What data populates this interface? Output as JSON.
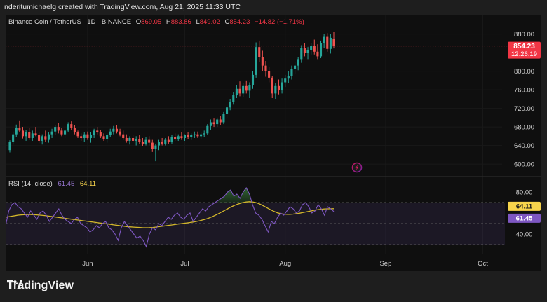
{
  "credit": "nderitumichaelg created with TradingView.com, Aug 21, 2025 11:33 UTC",
  "brand": {
    "name": "TradingView"
  },
  "colors": {
    "up": "#26a69a",
    "down": "#ef5350",
    "rsi_line": "#7e57c2",
    "rsi_ma": "#d4b82a",
    "price_tag": "#f23645",
    "rsi_tag_ma": "#f7d44c",
    "rsi_tag_line": "#7e57c2",
    "background": "#0f0f0f"
  },
  "legend": {
    "symbol": "Binance Coin / TetherUS · 1D · BINANCE",
    "o_label": "O",
    "o": "869.05",
    "h_label": "H",
    "h": "883.86",
    "l_label": "L",
    "l": "849.02",
    "c_label": "C",
    "c": "854.23",
    "change": "−14.82 (−1.71%)"
  },
  "price_tag": {
    "value": "854.23",
    "countdown": "12:26:19"
  },
  "rsi_legend": {
    "name": "RSI (14, close)",
    "value": "61.45",
    "ma_value": "64.11"
  },
  "rsi_tags": {
    "ma": "64.11",
    "line": "61.45"
  },
  "chart_data": [
    {
      "type": "candlestick",
      "title": "Binance Coin / TetherUS · 1D · BINANCE",
      "yticks": [
        "880.00",
        "800.00",
        "760.00",
        "720.00",
        "680.00",
        "640.00",
        "600.00"
      ],
      "ylim": [
        585,
        893
      ],
      "xticks": [
        "Jun",
        "Jul",
        "Aug",
        "Sep",
        "Oct"
      ],
      "last_close": 854.23,
      "candles": [
        {
          "o": 630,
          "h": 651,
          "l": 625,
          "c": 648
        },
        {
          "o": 648,
          "h": 670,
          "l": 642,
          "c": 664
        },
        {
          "o": 664,
          "h": 685,
          "l": 658,
          "c": 678
        },
        {
          "o": 678,
          "h": 694,
          "l": 668,
          "c": 672
        },
        {
          "o": 672,
          "h": 680,
          "l": 655,
          "c": 660
        },
        {
          "o": 660,
          "h": 674,
          "l": 650,
          "c": 668
        },
        {
          "o": 668,
          "h": 678,
          "l": 652,
          "c": 656
        },
        {
          "o": 656,
          "h": 672,
          "l": 650,
          "c": 666
        },
        {
          "o": 666,
          "h": 680,
          "l": 660,
          "c": 662
        },
        {
          "o": 662,
          "h": 668,
          "l": 645,
          "c": 650
        },
        {
          "o": 650,
          "h": 664,
          "l": 642,
          "c": 660
        },
        {
          "o": 660,
          "h": 672,
          "l": 648,
          "c": 652
        },
        {
          "o": 652,
          "h": 668,
          "l": 646,
          "c": 664
        },
        {
          "o": 664,
          "h": 676,
          "l": 656,
          "c": 670
        },
        {
          "o": 670,
          "h": 684,
          "l": 662,
          "c": 680
        },
        {
          "o": 680,
          "h": 688,
          "l": 666,
          "c": 672
        },
        {
          "o": 672,
          "h": 678,
          "l": 660,
          "c": 664
        },
        {
          "o": 664,
          "h": 676,
          "l": 656,
          "c": 672
        },
        {
          "o": 672,
          "h": 690,
          "l": 668,
          "c": 686
        },
        {
          "o": 686,
          "h": 692,
          "l": 674,
          "c": 678
        },
        {
          "o": 678,
          "h": 684,
          "l": 664,
          "c": 668
        },
        {
          "o": 668,
          "h": 672,
          "l": 656,
          "c": 660
        },
        {
          "o": 660,
          "h": 666,
          "l": 650,
          "c": 656
        },
        {
          "o": 656,
          "h": 668,
          "l": 648,
          "c": 664
        },
        {
          "o": 664,
          "h": 670,
          "l": 652,
          "c": 656
        },
        {
          "o": 656,
          "h": 668,
          "l": 646,
          "c": 662
        },
        {
          "o": 662,
          "h": 676,
          "l": 656,
          "c": 672
        },
        {
          "o": 672,
          "h": 680,
          "l": 664,
          "c": 668
        },
        {
          "o": 668,
          "h": 674,
          "l": 656,
          "c": 660
        },
        {
          "o": 660,
          "h": 666,
          "l": 650,
          "c": 654
        },
        {
          "o": 654,
          "h": 666,
          "l": 646,
          "c": 662
        },
        {
          "o": 662,
          "h": 676,
          "l": 658,
          "c": 670
        },
        {
          "o": 670,
          "h": 682,
          "l": 664,
          "c": 676
        },
        {
          "o": 676,
          "h": 684,
          "l": 666,
          "c": 670
        },
        {
          "o": 670,
          "h": 676,
          "l": 660,
          "c": 664
        },
        {
          "o": 664,
          "h": 672,
          "l": 652,
          "c": 656
        },
        {
          "o": 656,
          "h": 664,
          "l": 646,
          "c": 650
        },
        {
          "o": 650,
          "h": 660,
          "l": 642,
          "c": 656
        },
        {
          "o": 656,
          "h": 662,
          "l": 646,
          "c": 650
        },
        {
          "o": 650,
          "h": 660,
          "l": 640,
          "c": 654
        },
        {
          "o": 654,
          "h": 662,
          "l": 644,
          "c": 648
        },
        {
          "o": 648,
          "h": 656,
          "l": 638,
          "c": 644
        },
        {
          "o": 644,
          "h": 658,
          "l": 640,
          "c": 652
        },
        {
          "o": 652,
          "h": 660,
          "l": 640,
          "c": 646
        },
        {
          "o": 646,
          "h": 652,
          "l": 626,
          "c": 632
        },
        {
          "o": 632,
          "h": 644,
          "l": 606,
          "c": 640
        },
        {
          "o": 640,
          "h": 652,
          "l": 630,
          "c": 648
        },
        {
          "o": 648,
          "h": 656,
          "l": 640,
          "c": 644
        },
        {
          "o": 644,
          "h": 656,
          "l": 640,
          "c": 652
        },
        {
          "o": 652,
          "h": 660,
          "l": 644,
          "c": 648
        },
        {
          "o": 648,
          "h": 662,
          "l": 644,
          "c": 658
        },
        {
          "o": 658,
          "h": 666,
          "l": 650,
          "c": 654
        },
        {
          "o": 654,
          "h": 664,
          "l": 650,
          "c": 660
        },
        {
          "o": 660,
          "h": 668,
          "l": 652,
          "c": 656
        },
        {
          "o": 656,
          "h": 664,
          "l": 650,
          "c": 662
        },
        {
          "o": 662,
          "h": 668,
          "l": 654,
          "c": 658
        },
        {
          "o": 658,
          "h": 666,
          "l": 652,
          "c": 662
        },
        {
          "o": 662,
          "h": 670,
          "l": 656,
          "c": 664
        },
        {
          "o": 664,
          "h": 670,
          "l": 656,
          "c": 660
        },
        {
          "o": 660,
          "h": 668,
          "l": 654,
          "c": 664
        },
        {
          "o": 664,
          "h": 672,
          "l": 658,
          "c": 666
        },
        {
          "o": 666,
          "h": 686,
          "l": 662,
          "c": 682
        },
        {
          "o": 682,
          "h": 696,
          "l": 674,
          "c": 690
        },
        {
          "o": 690,
          "h": 698,
          "l": 680,
          "c": 686
        },
        {
          "o": 686,
          "h": 700,
          "l": 680,
          "c": 696
        },
        {
          "o": 696,
          "h": 704,
          "l": 684,
          "c": 690
        },
        {
          "o": 690,
          "h": 712,
          "l": 686,
          "c": 708
        },
        {
          "o": 708,
          "h": 728,
          "l": 700,
          "c": 722
        },
        {
          "o": 722,
          "h": 740,
          "l": 716,
          "c": 734
        },
        {
          "o": 734,
          "h": 754,
          "l": 728,
          "c": 748
        },
        {
          "o": 748,
          "h": 770,
          "l": 742,
          "c": 762
        },
        {
          "o": 762,
          "h": 778,
          "l": 746,
          "c": 752
        },
        {
          "o": 752,
          "h": 774,
          "l": 744,
          "c": 768
        },
        {
          "o": 768,
          "h": 780,
          "l": 752,
          "c": 758
        },
        {
          "o": 758,
          "h": 776,
          "l": 742,
          "c": 770
        },
        {
          "o": 770,
          "h": 800,
          "l": 762,
          "c": 792
        },
        {
          "o": 792,
          "h": 862,
          "l": 786,
          "c": 852
        },
        {
          "o": 852,
          "h": 866,
          "l": 820,
          "c": 830
        },
        {
          "o": 830,
          "h": 844,
          "l": 800,
          "c": 812
        },
        {
          "o": 812,
          "h": 822,
          "l": 788,
          "c": 800
        },
        {
          "o": 800,
          "h": 810,
          "l": 776,
          "c": 786
        },
        {
          "o": 786,
          "h": 790,
          "l": 742,
          "c": 752
        },
        {
          "o": 752,
          "h": 774,
          "l": 740,
          "c": 768
        },
        {
          "o": 768,
          "h": 782,
          "l": 750,
          "c": 760
        },
        {
          "o": 760,
          "h": 784,
          "l": 752,
          "c": 776
        },
        {
          "o": 776,
          "h": 792,
          "l": 766,
          "c": 784
        },
        {
          "o": 784,
          "h": 800,
          "l": 774,
          "c": 790
        },
        {
          "o": 790,
          "h": 812,
          "l": 782,
          "c": 804
        },
        {
          "o": 804,
          "h": 820,
          "l": 794,
          "c": 812
        },
        {
          "o": 812,
          "h": 830,
          "l": 802,
          "c": 826
        },
        {
          "o": 826,
          "h": 856,
          "l": 818,
          "c": 850
        },
        {
          "o": 850,
          "h": 860,
          "l": 832,
          "c": 840
        },
        {
          "o": 840,
          "h": 852,
          "l": 826,
          "c": 846
        },
        {
          "o": 846,
          "h": 860,
          "l": 836,
          "c": 854
        },
        {
          "o": 854,
          "h": 868,
          "l": 836,
          "c": 842
        },
        {
          "o": 842,
          "h": 858,
          "l": 826,
          "c": 832
        },
        {
          "o": 832,
          "h": 866,
          "l": 828,
          "c": 860
        },
        {
          "o": 860,
          "h": 880,
          "l": 850,
          "c": 874
        },
        {
          "o": 874,
          "h": 882,
          "l": 842,
          "c": 848
        },
        {
          "o": 848,
          "h": 880,
          "l": 838,
          "c": 872
        },
        {
          "o": 869.05,
          "h": 883.86,
          "l": 849.02,
          "c": 854.23
        }
      ]
    },
    {
      "type": "line",
      "title": "RSI (14, close)",
      "yticks": [
        "80.00",
        "40.00"
      ],
      "ylim": [
        24,
        84
      ],
      "bands": {
        "upper": 70,
        "middle": 50,
        "lower": 30
      },
      "series": [
        {
          "name": "RSI",
          "values": [
            48,
            62,
            68,
            70,
            66,
            64,
            60,
            56,
            62,
            58,
            54,
            60,
            62,
            58,
            52,
            56,
            60,
            64,
            58,
            54,
            52,
            50,
            54,
            56,
            50,
            48,
            46,
            42,
            44,
            48,
            46,
            50,
            52,
            46,
            44,
            40,
            34,
            46,
            52,
            48,
            44,
            40,
            36,
            38,
            34,
            28,
            40,
            46,
            44,
            50,
            48,
            52,
            56,
            54,
            58,
            60,
            56,
            54,
            58,
            60,
            52,
            56,
            60,
            64,
            62,
            66,
            68,
            70,
            72,
            74,
            76,
            80,
            82,
            76,
            78,
            74,
            80,
            84,
            78,
            68,
            60,
            58,
            54,
            48,
            42,
            52,
            50,
            56,
            60,
            58,
            62,
            66,
            64,
            60,
            62,
            68,
            70,
            66,
            60,
            62,
            68,
            64,
            58,
            66,
            64,
            61.45
          ]
        },
        {
          "name": "MA",
          "values": [
            56,
            56.5,
            57,
            57.5,
            58,
            58.3,
            58.5,
            58.6,
            58.6,
            58.5,
            58.3,
            58,
            57.7,
            57.4,
            57,
            56.6,
            56.2,
            55.8,
            55.4,
            55,
            54.6,
            54.2,
            53.8,
            53.4,
            53,
            52.6,
            52.2,
            51.8,
            51.4,
            51,
            50.6,
            50.2,
            49.8,
            49.4,
            49,
            48.6,
            48.2,
            47.8,
            47.4,
            47,
            46.8,
            46.6,
            46.4,
            46.2,
            46,
            46,
            46.1,
            46.3,
            46.6,
            47,
            47.4,
            47.8,
            48.2,
            48.6,
            49,
            49.4,
            49.8,
            50.2,
            50.6,
            51,
            51.5,
            52,
            52.6,
            53.4,
            54.2,
            55.2,
            56.4,
            57.8,
            59.2,
            60.8,
            62.4,
            64,
            65.6,
            67,
            68.2,
            69.2,
            70,
            70.6,
            70.8,
            70.6,
            70,
            69,
            67.6,
            66,
            64.4,
            62.8,
            61.4,
            60.2,
            59.4,
            59,
            58.8,
            58.8,
            59,
            59.4,
            59.8,
            60.4,
            61,
            61.6,
            62.2,
            62.8,
            63.3,
            63.6,
            63.9,
            64,
            64.1,
            64.11
          ]
        }
      ]
    }
  ]
}
